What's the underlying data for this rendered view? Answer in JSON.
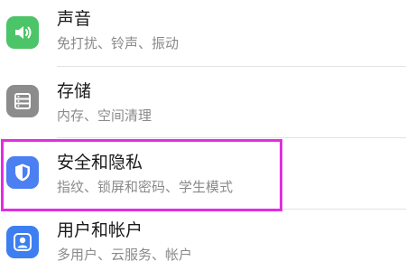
{
  "settings": {
    "items": [
      {
        "title": "声音",
        "subtitle": "免打扰、铃声、振动",
        "icon": "speaker-icon",
        "color": "#4cc468"
      },
      {
        "title": "存储",
        "subtitle": "内存、空间清理",
        "icon": "storage-icon",
        "color": "#8c8c8c"
      },
      {
        "title": "安全和隐私",
        "subtitle": "指纹、锁屏和密码、学生模式",
        "icon": "shield-icon",
        "color": "#4b7ff2"
      },
      {
        "title": "用户和帐户",
        "subtitle": "多用户、云服务、帐户",
        "icon": "user-icon",
        "color": "#3d7ff0"
      }
    ],
    "highlight_color": "#e22ee2"
  }
}
